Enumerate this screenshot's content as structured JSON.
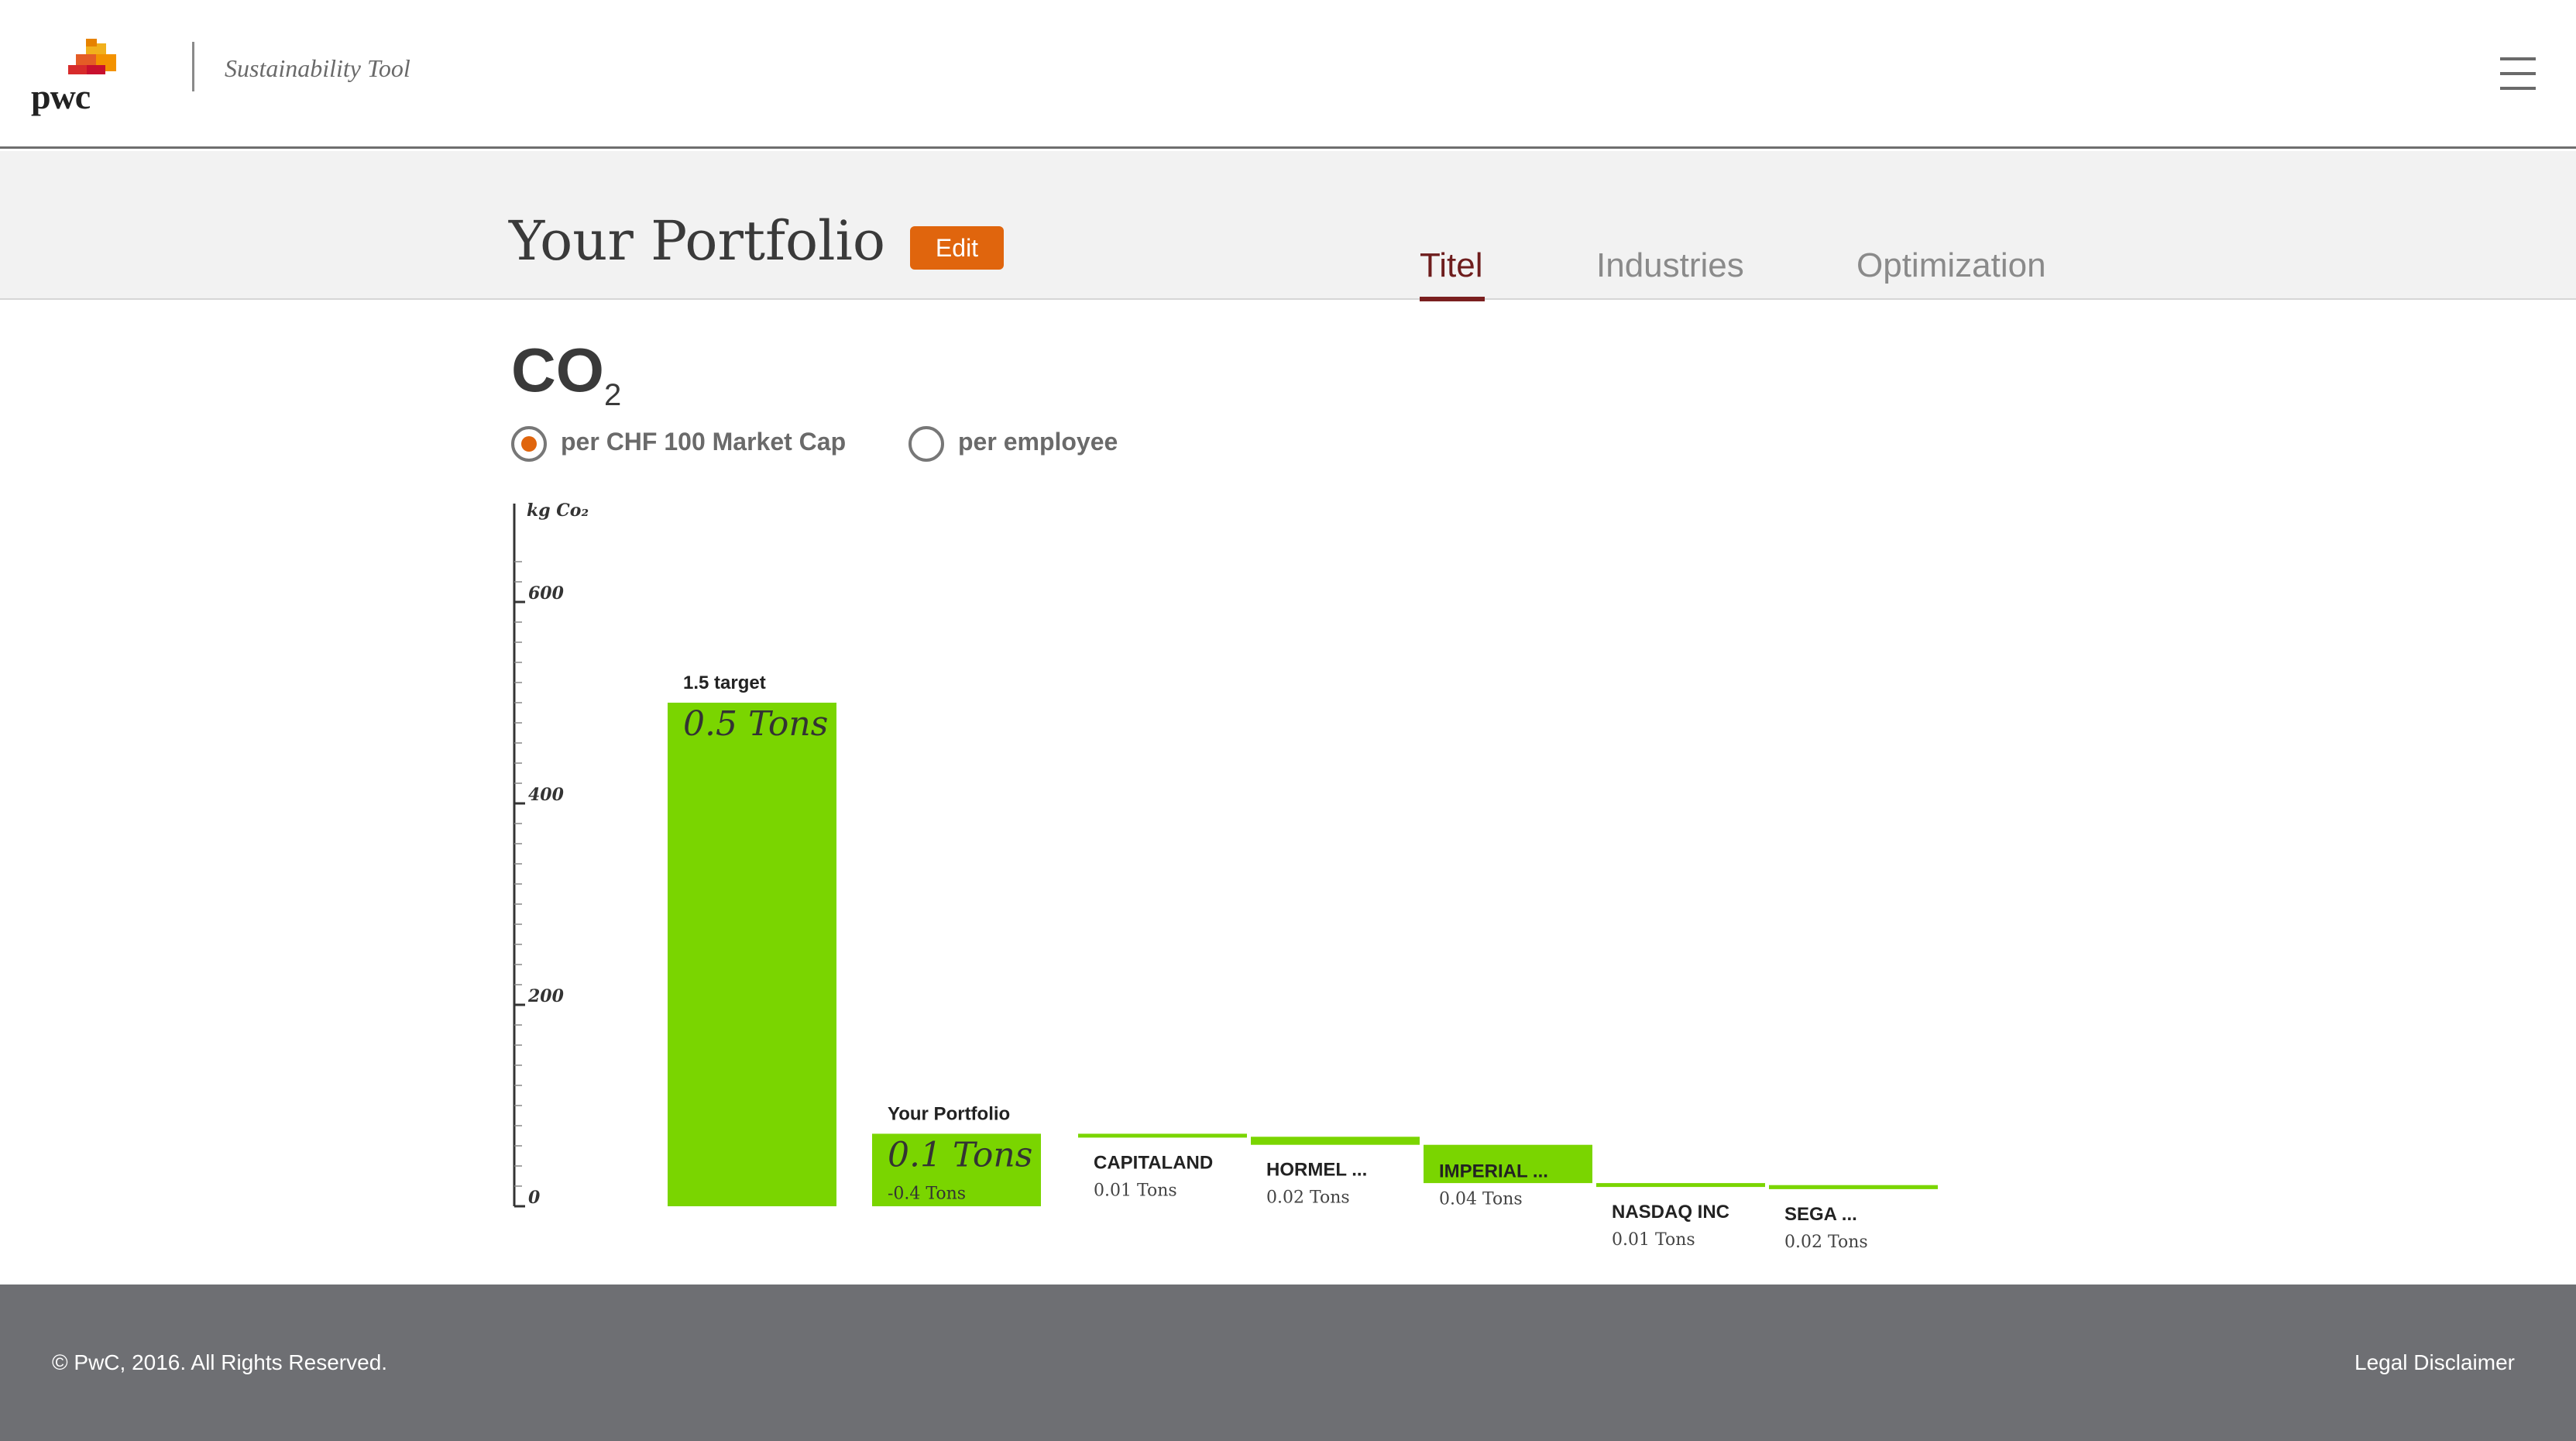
{
  "header": {
    "logo_text": "pwc",
    "app_title": "Sustainability Tool",
    "menu_icon": "hamburger-menu-icon"
  },
  "portfolio": {
    "title": "Your Portfolio",
    "edit_label": "Edit",
    "tabs": [
      {
        "label": "Titel",
        "active": true
      },
      {
        "label": "Industries",
        "active": false
      },
      {
        "label": "Optimization",
        "active": false
      }
    ]
  },
  "metric": {
    "main": "CO",
    "subscript": "2",
    "options": [
      {
        "label": "per CHF 100 Market Cap",
        "selected": true
      },
      {
        "label": "per employee",
        "selected": false
      }
    ]
  },
  "colors": {
    "accent": "#e0650d",
    "bar": "#7ad500",
    "active_tab": "#6e1d1d",
    "footer": "#6e6f73"
  },
  "chart_data": {
    "type": "bar",
    "ylabel": "kg Co₂",
    "ylim": [
      0,
      700
    ],
    "yticks": [
      0,
      200,
      400,
      600
    ],
    "target": {
      "name": "1.5 target",
      "label": "0.5 Tons",
      "value": 500
    },
    "portfolio": {
      "name": "Your Portfolio",
      "label": "0.1 Tons",
      "delta": "-0.4 Tons",
      "value": 72
    },
    "holdings": [
      {
        "name": "CAPITALAND",
        "label": "0.01 Tons",
        "value": 3
      },
      {
        "name": "HORMEL ...",
        "label": "0.02 Tons",
        "value": 8
      },
      {
        "name": "IMPERIAL ...",
        "label": "0.04 Tons",
        "value": 38
      },
      {
        "name": "NASDAQ INC",
        "label": "0.01 Tons",
        "value": 2
      },
      {
        "name": "SEGA ...",
        "label": "0.02 Tons",
        "value": 4
      }
    ]
  },
  "footer": {
    "copyright": "© PwC, 2016. All Rights Reserved.",
    "legal": "Legal Disclaimer"
  }
}
